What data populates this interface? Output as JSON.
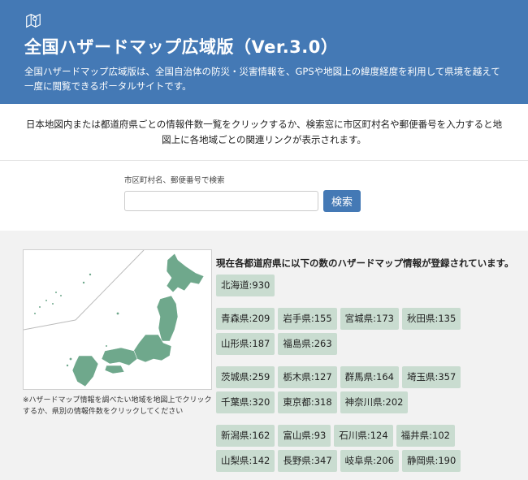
{
  "header": {
    "title": "全国ハザードマップ広域版（Ver.3.0）",
    "description": "全国ハザードマップ広域版は、全国自治体の防災・災害情報を、GPSや地図上の緯度経度を利用して県境を越えて一度に閲覧できるポータルサイトです。"
  },
  "intro": {
    "text": "日本地図内または都道府県ごとの情報件数一覧をクリックするか、検索窓に市区町村名や郵便番号を入力すると地図上に各地域ごとの関連リンクが表示されます。"
  },
  "search": {
    "label": "市区町村名、郵便番号で検索",
    "placeholder": "",
    "button": "検索"
  },
  "map": {
    "note": "※ハザードマップ情報を調べたい地域を地図上でクリックするか、県別の情報件数をクリックしてください",
    "fill_color": "#6fa88c"
  },
  "counts": {
    "heading": "現在各都道府県に以下の数のハザードマップ情報が登録されています。",
    "regions": [
      [
        "北海道:930"
      ],
      [
        "青森県:209",
        "岩手県:155",
        "宮城県:173",
        "秋田県:135",
        "山形県:187",
        "福島県:263"
      ],
      [
        "茨城県:259",
        "栃木県:127",
        "群馬県:164",
        "埼玉県:357",
        "千葉県:320",
        "東京都:318",
        "神奈川県:202"
      ],
      [
        "新潟県:162",
        "富山県:93",
        "石川県:124",
        "福井県:102",
        "山梨県:142",
        "長野県:347",
        "岐阜県:206",
        "静岡県:190"
      ]
    ]
  },
  "colors": {
    "header_bg": "#4479b5",
    "chip_bg": "#c9dcd0",
    "section_bg": "#f2f2f2"
  }
}
